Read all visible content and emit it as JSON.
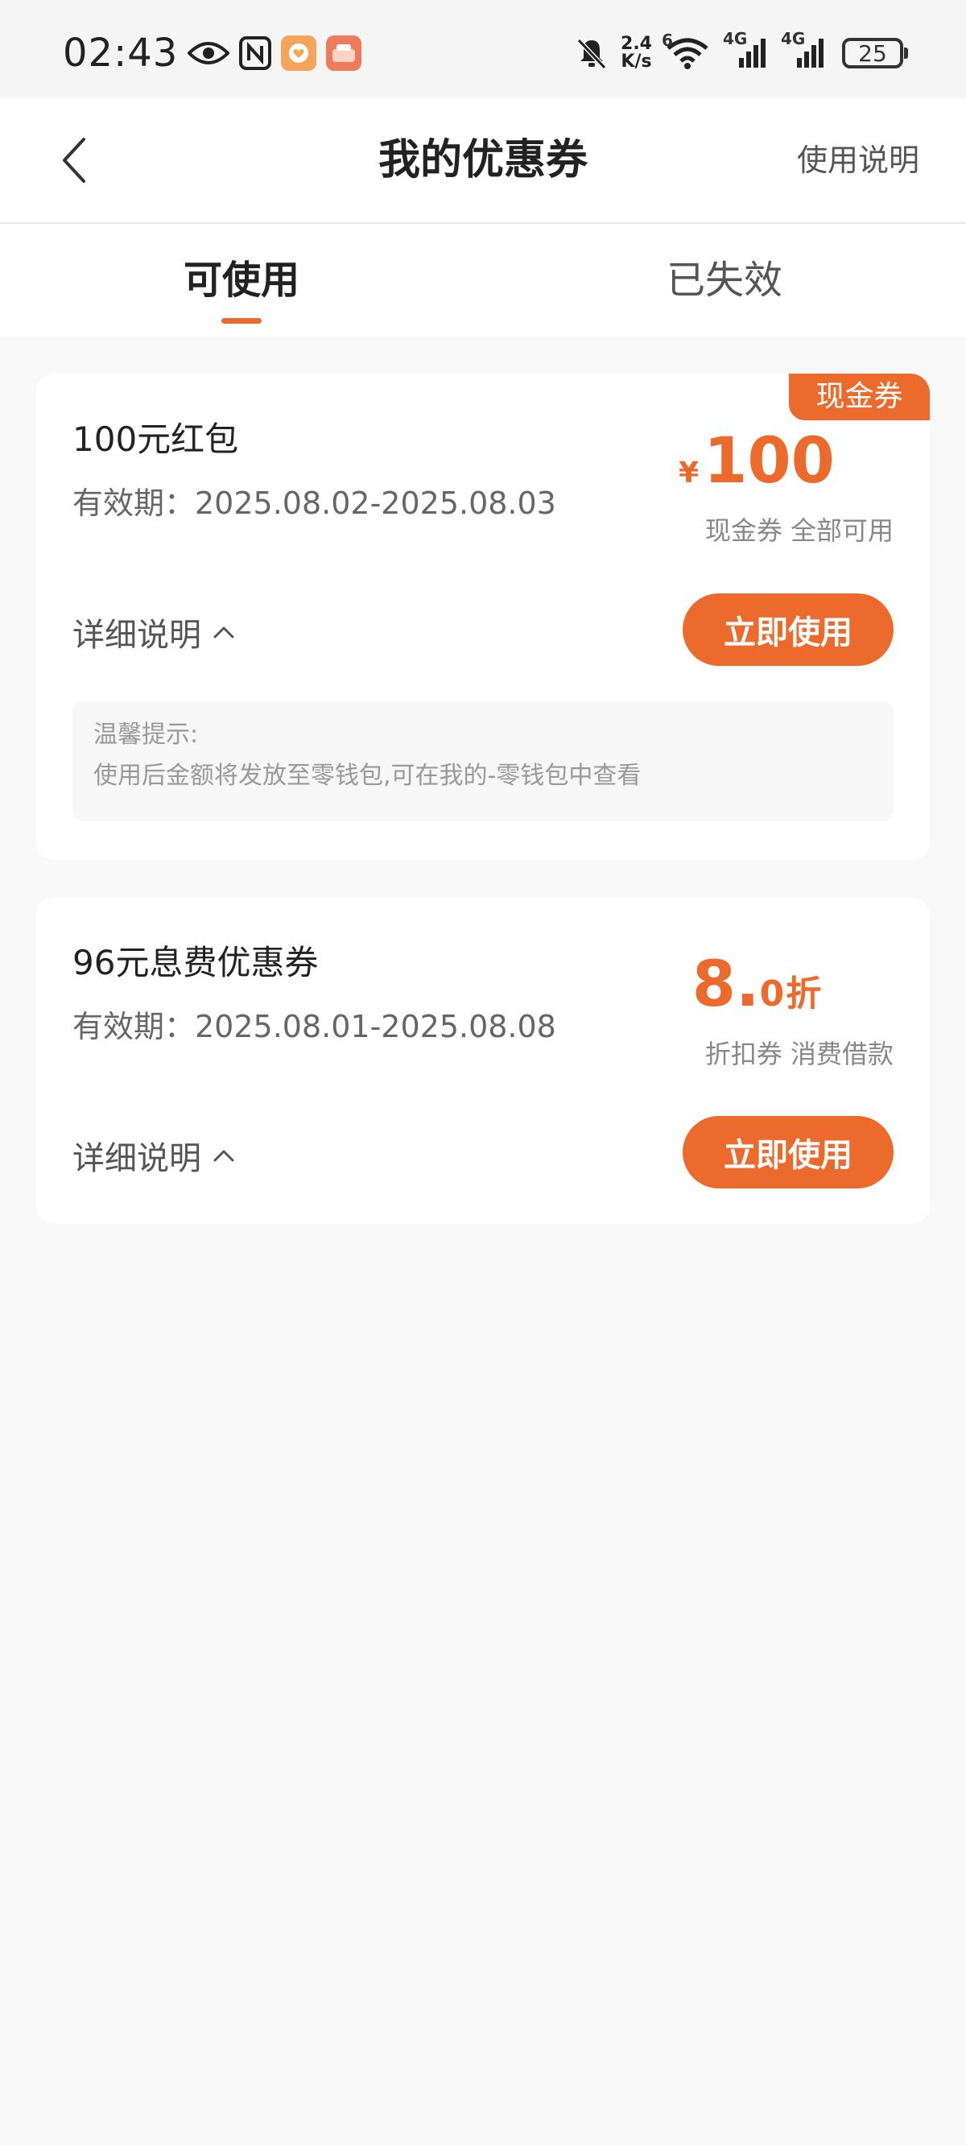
{
  "status_bar": {
    "time": "02:43",
    "net_speed_value": "2.4",
    "net_speed_unit": "K/s",
    "wifi_label": "6",
    "signal1_label": "4G",
    "signal2_label": "4G",
    "battery": "25",
    "icons": [
      "eye-icon",
      "nfc-icon",
      "heart-app-icon",
      "shop-app-icon",
      "mute-bell-icon",
      "wifi-icon",
      "signal-icon",
      "battery-icon"
    ]
  },
  "nav": {
    "title": "我的优惠券",
    "right_label": "使用说明"
  },
  "tabs": [
    {
      "label": "可使用",
      "active": true
    },
    {
      "label": "已失效",
      "active": false
    }
  ],
  "coupons": [
    {
      "badge": "现金券",
      "title": "100元红包",
      "validity": "有效期：2025.08.02-2025.08.03",
      "currency": "¥",
      "amount": "100",
      "desc": "现金券 全部可用",
      "detail_label": "详细说明",
      "use_label": "立即使用",
      "tip_title": "温馨提示:",
      "tip_text": "使用后金额将发放至零钱包,可在我的-零钱包中查看"
    },
    {
      "title": "96元息费优惠券",
      "validity": "有效期：2025.08.01-2025.08.08",
      "discount_int": "8.",
      "discount_dec": "0",
      "discount_unit": "折",
      "desc": "折扣券 消费借款",
      "detail_label": "详细说明",
      "use_label": "立即使用"
    }
  ],
  "colors": {
    "accent": "#ec6a2c",
    "background": "#f8f8f8",
    "card": "#ffffff"
  }
}
